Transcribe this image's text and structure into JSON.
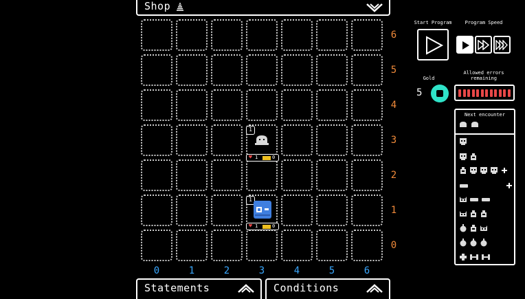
{
  "shop": {
    "title": "Shop"
  },
  "grid": {
    "row_labels": [
      "6",
      "5",
      "4",
      "3",
      "2",
      "1",
      "0"
    ],
    "col_labels": [
      "0",
      "1",
      "2",
      "3",
      "4",
      "5",
      "6"
    ]
  },
  "units": [
    {
      "name": "ghost",
      "badge": "1",
      "hp": "1",
      "energy": "0",
      "color": "#d9d9d9"
    },
    {
      "name": "robot",
      "badge": "1",
      "hp": "1",
      "energy": "0",
      "color": "#3f7fe0"
    }
  ],
  "bottom": {
    "statements": "Statements",
    "conditions": "Conditions"
  },
  "controls": {
    "start_program_label": "Start Program",
    "program_speed_label": "Program Speed",
    "gold_label": "Gold",
    "gold_value": "5",
    "allowed_errors_label_1": "Allowed errors",
    "allowed_errors_label_2": "remaining",
    "allowed_errors_remaining": 12,
    "next_encounter_label": "Next encounter"
  },
  "colors": {
    "row_label": "#f08a3a",
    "col_label": "#3aa8ff",
    "gold_coin": "#2fe3c8",
    "error_tick": "#e84848"
  }
}
